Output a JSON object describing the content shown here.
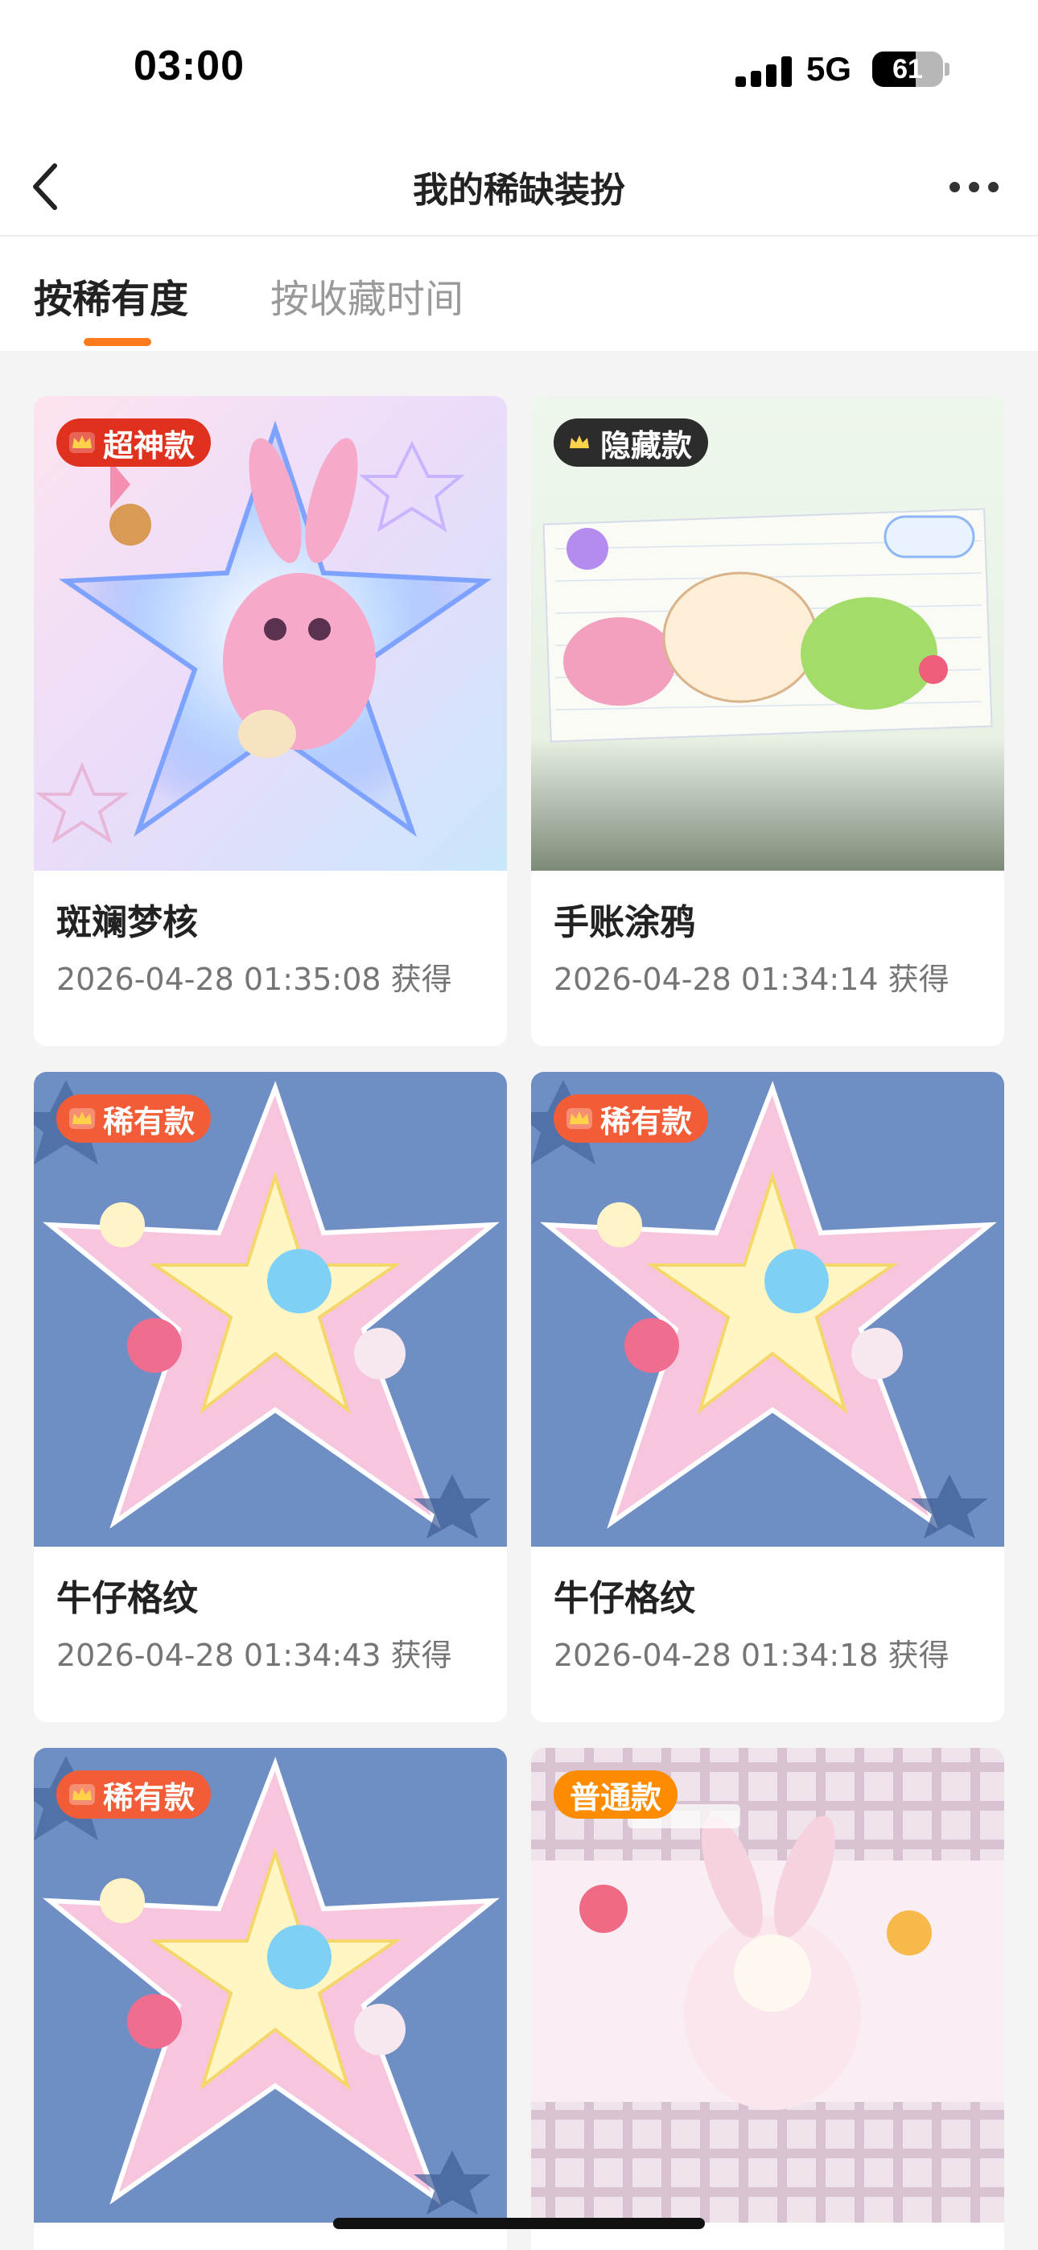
{
  "status_bar": {
    "time": "03:00",
    "network": "5G",
    "battery": "61",
    "battery_level": 0.61
  },
  "header": {
    "title": "我的稀缺装扮",
    "back_icon": "chevron-left-icon",
    "more_icon": "more-dots-icon"
  },
  "tabs": [
    {
      "label": "按稀有度",
      "active": true
    },
    {
      "label": "按收藏时间",
      "active": false
    }
  ],
  "colors": {
    "accent": "#ff7a1a",
    "badge_super": "#e0301e",
    "badge_hidden": "#2c2c2c",
    "badge_rare": "#f25d38",
    "badge_common": "#ff8c00"
  },
  "items": [
    {
      "badge": "超神款",
      "badge_color": "#e0301e",
      "crown": true,
      "name": "斑斓梦核",
      "date": "2026-04-28 01:35:08 获得",
      "art": "pink-bunny-star"
    },
    {
      "badge": "隐藏款",
      "badge_color": "#2c2c2c",
      "crown": true,
      "name": "手账涂鸦",
      "date": "2026-04-28 01:34:14 获得",
      "art": "journal-doodle"
    },
    {
      "badge": "稀有款",
      "badge_color": "#f25d38",
      "crown": true,
      "name": "牛仔格纹",
      "date": "2026-04-28 01:34:43 获得",
      "art": "denim-plaid"
    },
    {
      "badge": "稀有款",
      "badge_color": "#f25d38",
      "crown": true,
      "name": "牛仔格纹",
      "date": "2026-04-28 01:34:18 获得",
      "art": "denim-plaid"
    },
    {
      "badge": "稀有款",
      "badge_color": "#f25d38",
      "crown": true,
      "name": "",
      "date": "",
      "art": "denim-plaid"
    },
    {
      "badge": "普通款",
      "badge_color": "#ff8c00",
      "crown": false,
      "name": "",
      "date": "",
      "art": "pink-check-bunny"
    }
  ]
}
